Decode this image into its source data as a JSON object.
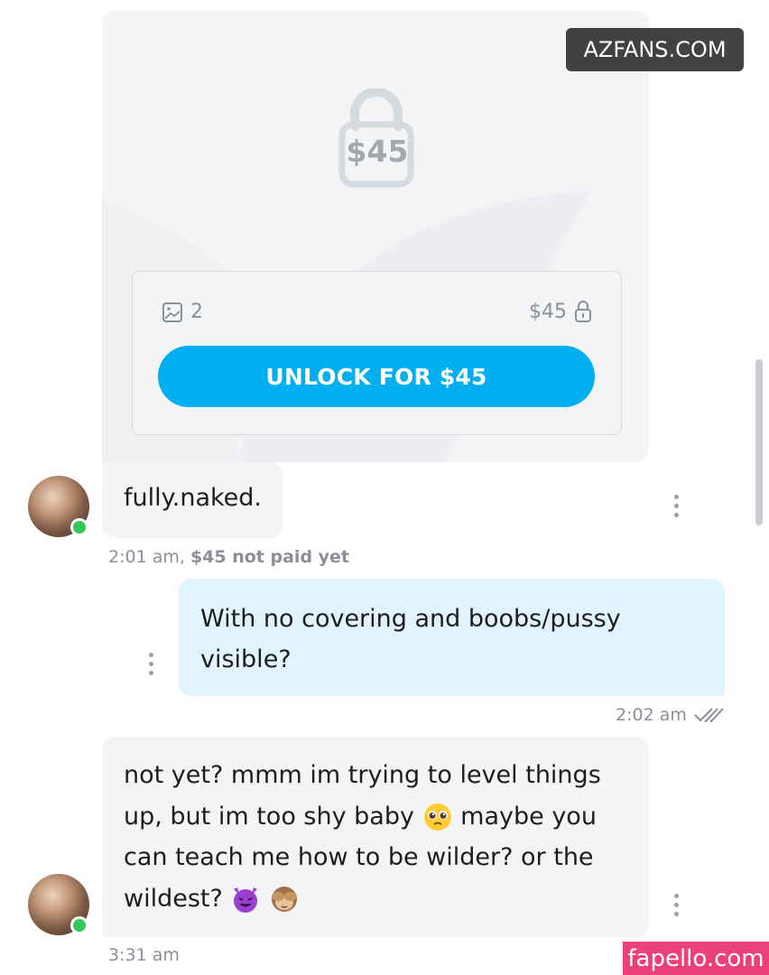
{
  "locked_post": {
    "big_price": "$45",
    "media_count": "2",
    "price_label": "$45",
    "unlock_button_label": "UNLOCK FOR $45"
  },
  "messages": [
    {
      "direction": "received",
      "text": "fully.naked.",
      "time": "2:01 am,",
      "payment_status": "$45 not paid yet"
    },
    {
      "direction": "sent",
      "text": "With no covering and boobs/pussy visible?",
      "time": "2:02 am"
    },
    {
      "direction": "received",
      "text_part1": "not yet? mmm im trying to level things up, but im too shy baby",
      "text_part2": "maybe you can teach me how to be wilder? or the wildest?",
      "time": "3:31 am"
    }
  ],
  "watermarks": {
    "top": "AZFANS.COM",
    "bottom": "fapello.com"
  },
  "colors": {
    "accent": "#00aff0",
    "received_bubble": "#f3f4f6",
    "sent_bubble": "#e1f4fd",
    "online": "#34c759"
  }
}
